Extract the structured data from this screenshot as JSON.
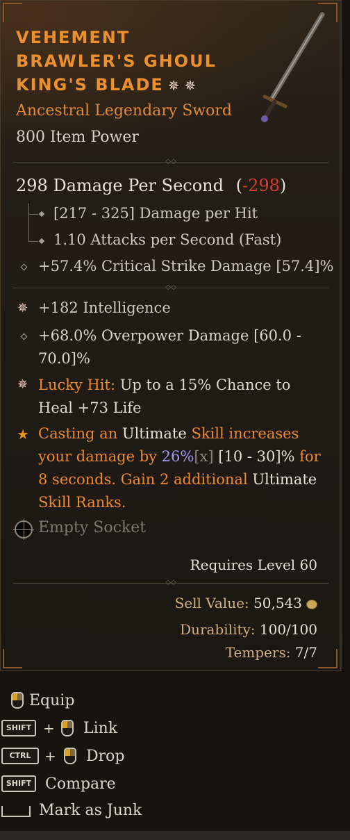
{
  "item": {
    "name_lines": [
      "Vehement",
      "Brawler's Ghoul",
      "King's Blade"
    ],
    "mythic_icons": "✵ ✵",
    "type": "Ancestral Legendary Sword",
    "item_power": "800 Item Power"
  },
  "dps": {
    "main": "298 Damage Per Second",
    "paren_open": "(",
    "delta": "-298",
    "paren_close": ")"
  },
  "weapon_stats": [
    "[217 - 325] Damage per Hit",
    "1.10 Attacks per Second (Fast)"
  ],
  "implicit": "+57.4% Critical Strike Damage [57.4]%",
  "affixes": {
    "intelligence": "+182 Intelligence",
    "overpower_line1": "+68.0% Overpower Damage [60.0 -",
    "overpower_line2": "70.0]%",
    "lucky_label": "Lucky Hit:",
    "lucky_line1_rest": " Up to a 15% Chance to",
    "lucky_line2": "Heal +73 Life"
  },
  "legendary": {
    "l1_a": "Casting an ",
    "l1_b": "Ultimate",
    "l1_c": " Skill increases",
    "l2_a": "your damage by ",
    "l2_b": "26%",
    "l2_c": "[x]",
    "l2_d": " [10 - 30]%",
    "l2_e": " for",
    "l3_a": "8 seconds. Gain 2 additional ",
    "l3_b": "Ultimate",
    "l4": "Skill Ranks."
  },
  "socket": "Empty Socket",
  "requires": "Requires Level 60",
  "sell": {
    "label": "Sell Value:",
    "value": " 50,543"
  },
  "durability": {
    "label": "Durability:",
    "value": " 100/100"
  },
  "tempers": {
    "label": "Tempers:",
    "value": " 7/7"
  },
  "controls": {
    "equip": "Equip",
    "link": "Link",
    "drop": "Drop",
    "compare": "Compare",
    "junk": "Mark as Junk",
    "shift_key": "SHIFT",
    "ctrl_key": "CTRL",
    "plus": "+"
  },
  "colors": {
    "legendary_orange": "#ef8a2a",
    "negative_red": "#d83a2a",
    "roll_purple": "#9f9bff",
    "mouse_gold": "#d7a12b"
  }
}
